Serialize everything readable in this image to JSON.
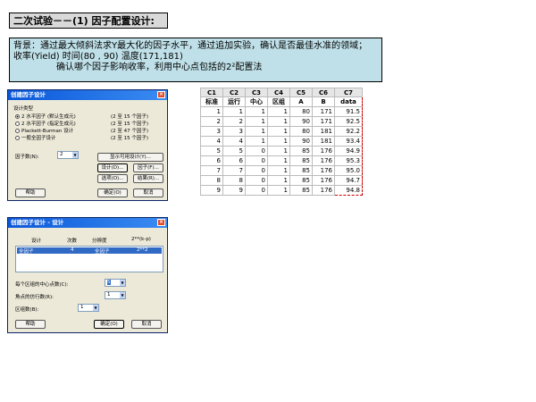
{
  "title": "二次试验－－(1) 因子配置设计:",
  "background": {
    "line1": "背景：通过最大倾斜法求Y最大化的因子水平，通过追加实验，确认是否最佳水准的领域；",
    "line2": "收率(Yield)      时间(80 , 90)   温度(171,181)",
    "line3": "确认哪个因子影响收率，利用中心点包括的2²配置法"
  },
  "dialog1": {
    "title": "创建因子设计",
    "design_type_label": "设计类型",
    "options": [
      {
        "label": "2 水平因子 (默认生成元)",
        "range": "(2 至 15 个因子)",
        "selected": true
      },
      {
        "label": "2 水平因子 (指定生成元)",
        "range": "(2 至 15 个因子)",
        "selected": false
      },
      {
        "label": "Plackett-Burman 设计",
        "range": "(2 至 47 个因子)",
        "selected": false
      },
      {
        "label": "一般全因子设计",
        "range": "(2 至 15 个因子)",
        "selected": false
      }
    ],
    "factor_count_label": "因子数(N):",
    "factor_count_value": "2",
    "show_designs_btn": "显示可用设计(Y)...",
    "design_btn": "设计(D)...",
    "factor_btn": "因子(F)...",
    "options_btn": "选项(O)...",
    "results_btn": "结果(R)...",
    "help_btn": "帮助",
    "ok_btn": "确定(O)",
    "cancel_btn": "取消"
  },
  "dialog2": {
    "title": "创建因子设计 - 设计",
    "columns": [
      "设计",
      "次数",
      "分辨度",
      "2**(k-p)"
    ],
    "row": {
      "design": "全因子",
      "runs": "4",
      "resolution": "全因子",
      "kp": "2**2"
    },
    "center_label": "每个区组的中心点数(C):",
    "center_value": "5",
    "corner_label": "角点的仿行数(R):",
    "corner_value": "1",
    "blocks_label": "区组数(B):",
    "blocks_value": "1",
    "help_btn": "帮助",
    "ok_btn": "确定(O)",
    "cancel_btn": "取消"
  },
  "table": {
    "col_ids": [
      "C1",
      "C2",
      "C3",
      "C4",
      "C5",
      "C6",
      "C7"
    ],
    "col_names": [
      "标准",
      "运行",
      "中心",
      "区组",
      "A",
      "B",
      "data"
    ],
    "rows": [
      [
        "1",
        "1",
        "1",
        "1",
        "80",
        "171",
        "91.5"
      ],
      [
        "2",
        "2",
        "1",
        "1",
        "90",
        "171",
        "92.5"
      ],
      [
        "3",
        "3",
        "1",
        "1",
        "80",
        "181",
        "92.2"
      ],
      [
        "4",
        "4",
        "1",
        "1",
        "90",
        "181",
        "93.4"
      ],
      [
        "5",
        "5",
        "0",
        "1",
        "85",
        "176",
        "94.9"
      ],
      [
        "6",
        "6",
        "0",
        "1",
        "85",
        "176",
        "95.3"
      ],
      [
        "7",
        "7",
        "0",
        "1",
        "85",
        "176",
        "95.0"
      ],
      [
        "8",
        "8",
        "0",
        "1",
        "85",
        "176",
        "94.7"
      ],
      [
        "9",
        "9",
        "0",
        "1",
        "85",
        "176",
        "94.8"
      ]
    ]
  }
}
